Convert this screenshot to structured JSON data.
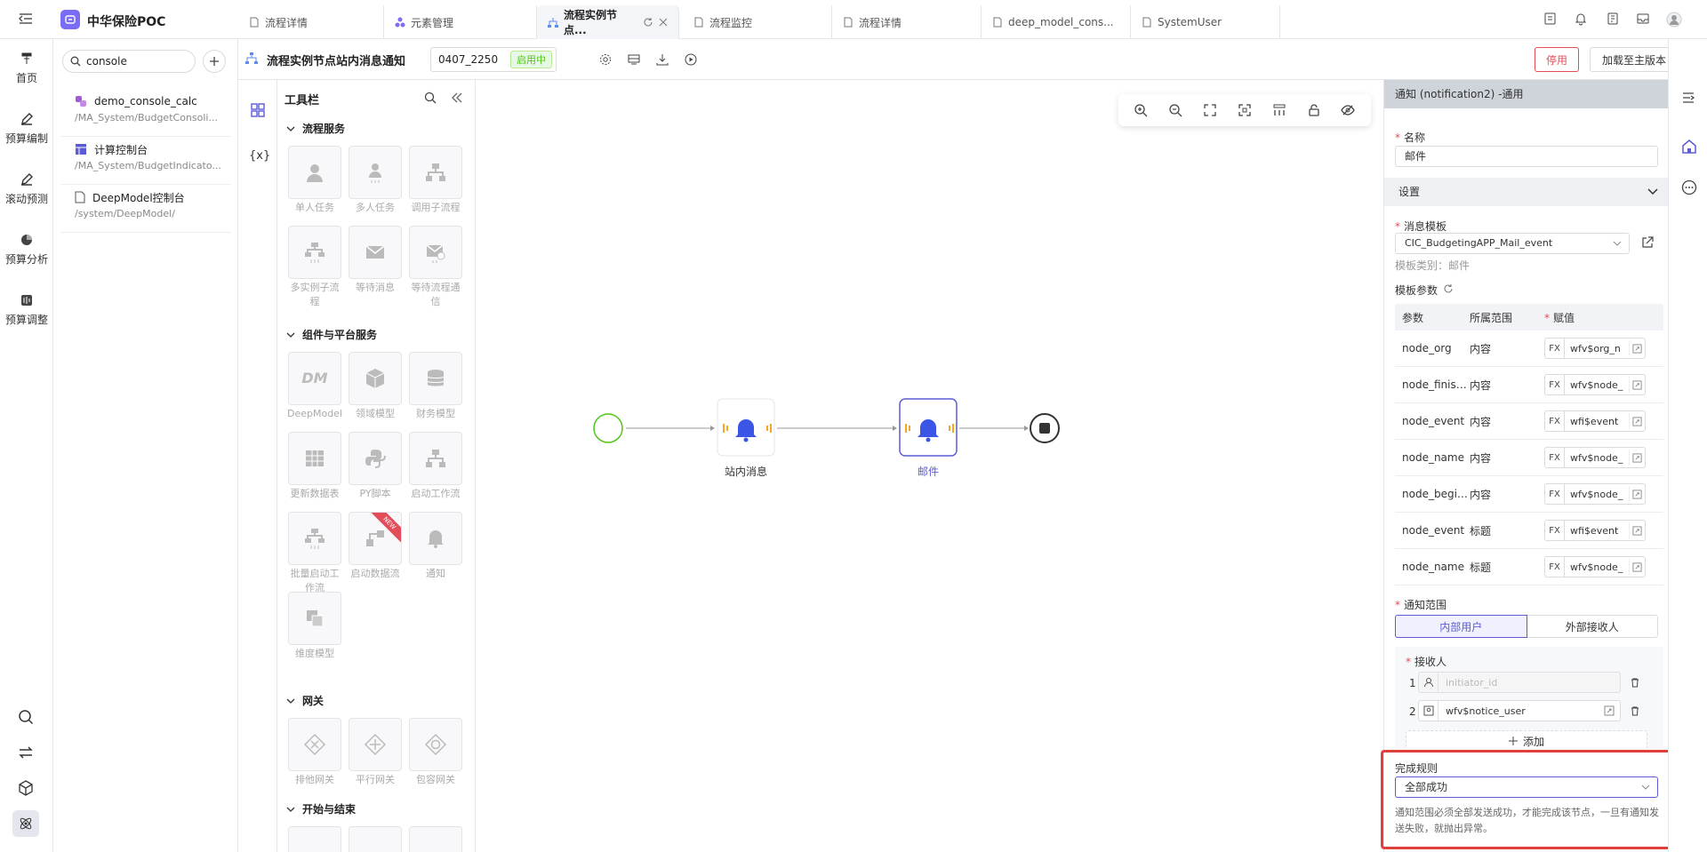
{
  "app": {
    "title": "中华保险POC"
  },
  "tabs": [
    {
      "label": "流程详情",
      "active": false
    },
    {
      "label": "元素管理",
      "active": false
    },
    {
      "label": "流程实例节点...",
      "active": true
    },
    {
      "label": "流程监控",
      "active": false
    },
    {
      "label": "流程详情",
      "active": false
    },
    {
      "label": "deep_model_cons...",
      "active": false
    },
    {
      "label": "SystemUser",
      "active": false
    }
  ],
  "nav": {
    "items": [
      {
        "label": "首页",
        "icon": "pin-icon"
      },
      {
        "label": "预算编制",
        "icon": "pen-icon"
      },
      {
        "label": "滚动预测",
        "icon": "pen-icon"
      },
      {
        "label": "预算分析",
        "icon": "pie-icon"
      },
      {
        "label": "预算调整",
        "icon": "adjust-icon"
      }
    ]
  },
  "search": {
    "value": "console",
    "results": [
      {
        "title": "demo_console_calc",
        "path": "/MA_System/BudgetConsoli..."
      },
      {
        "title": "计算控制台",
        "path": "/MA_System/BudgetIndicato..."
      },
      {
        "title": "DeepModel控制台",
        "path": "/system/DeepModel/"
      }
    ]
  },
  "header": {
    "title": "流程实例节点站内消息通知",
    "version": "0407_2250",
    "status": "启用中",
    "disable_btn": "停用",
    "load_btn": "加载至主版本"
  },
  "toolbox": {
    "title": "工具栏",
    "var_icon": "{x}",
    "sections": {
      "s1": "流程服务",
      "s2": "组件与平台服务",
      "s3": "网关",
      "s4": "开始与结束"
    },
    "tools": {
      "t1": "单人任务",
      "t2": "多人任务",
      "t3": "调用子流程",
      "t4": "多实例子流程",
      "t5": "等待消息",
      "t6": "等待流程通信",
      "t7": "DeepModel",
      "t8": "领域模型",
      "t9": "财务模型",
      "t10": "更新数据表",
      "t11": "PY脚本",
      "t12": "启动工作流",
      "t13": "批量启动工作流",
      "t14": "启动数据流",
      "t15": "通知",
      "t16": "维度模型",
      "t17": "排他网关",
      "t18": "平行网关",
      "t19": "包容网关"
    },
    "dm_label": "DM",
    "new_badge": "NEW"
  },
  "flow": {
    "node1": "站内消息",
    "node2": "邮件"
  },
  "panel": {
    "title": "通知 (notification2) -通用",
    "name_label": "名称",
    "name_value": "邮件",
    "settings_label": "设置",
    "template_label": "消息模板",
    "template_value": "CIC_BudgetingAPP_Mail_event",
    "template_type": "模板类别：邮件",
    "params_label": "模板参数",
    "col_param": "参数",
    "col_scope": "所属范围",
    "col_value": "赋值",
    "fx_label": "FX",
    "params": [
      {
        "name": "node_org",
        "scope": "内容",
        "value": "wfv$org_n"
      },
      {
        "name": "node_finish_...",
        "scope": "内容",
        "value": "wfv$node_"
      },
      {
        "name": "node_event",
        "scope": "内容",
        "value": "wfi$event"
      },
      {
        "name": "node_name",
        "scope": "内容",
        "value": "wfv$node_"
      },
      {
        "name": "node_begin...",
        "scope": "内容",
        "value": "wfv$node_"
      },
      {
        "name": "node_event",
        "scope": "标题",
        "value": "wfi$event"
      },
      {
        "name": "node_name",
        "scope": "标题",
        "value": "wfv$node_"
      }
    ],
    "scope_label": "通知范围",
    "scope_internal": "内部用户",
    "scope_external": "外部接收人",
    "receiver_label": "接收人",
    "receivers": [
      {
        "idx": "1",
        "value": "initiator_id"
      },
      {
        "idx": "2",
        "value": "wfv$notice_user"
      }
    ],
    "add_btn": "添加",
    "rule_label": "完成规则",
    "rule_value": "全部成功",
    "rule_desc": "通知范围必须全部发送成功，才能完成该节点，一旦有通知发送失败，就抛出异常。"
  },
  "colors": {
    "accent": "#5b5bd6",
    "danger": "#e34d59",
    "success": "#52c41a",
    "highlight_box": "#e0403a"
  }
}
